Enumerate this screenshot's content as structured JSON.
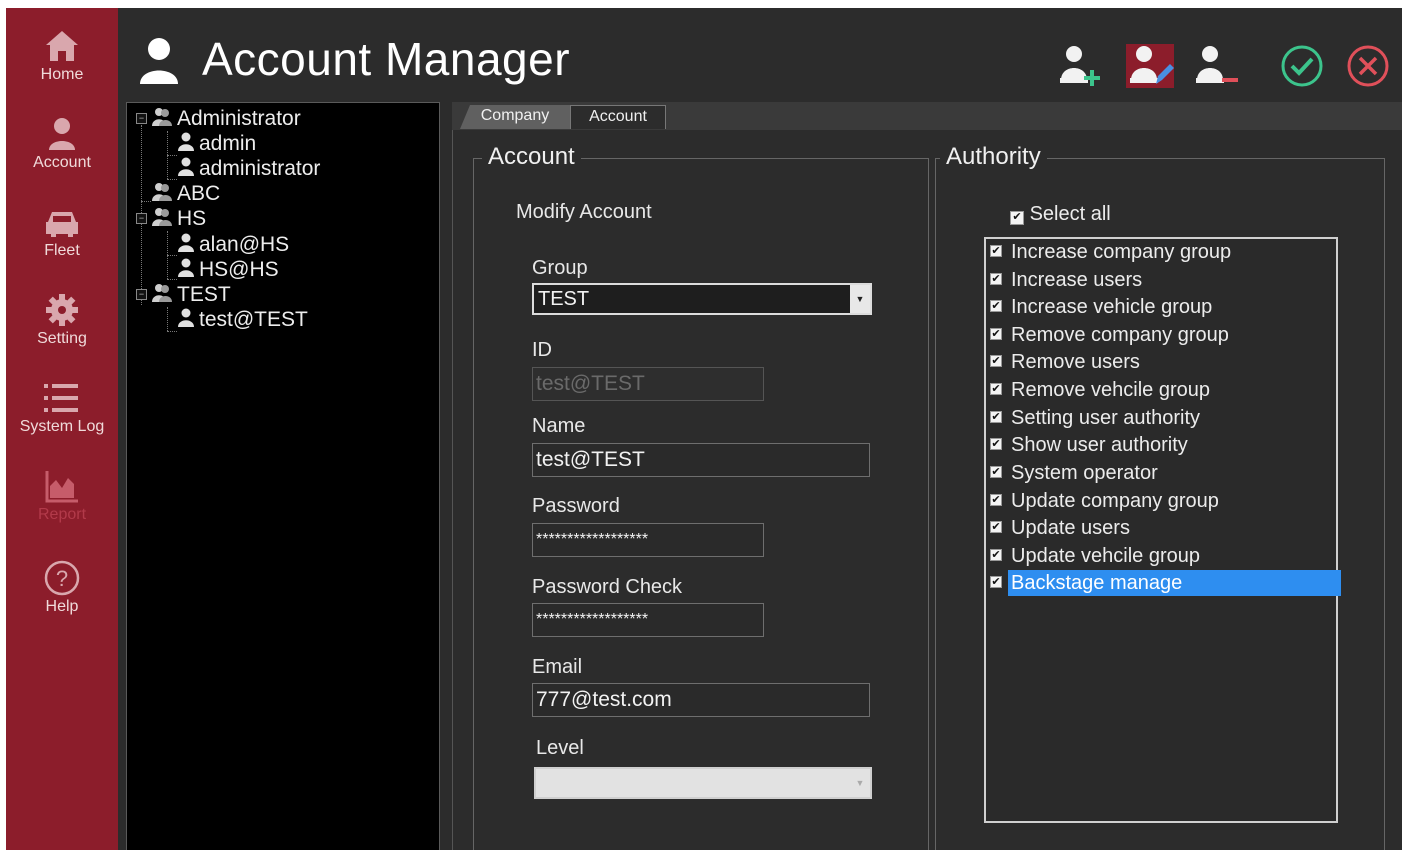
{
  "app": {
    "title": "Account Manager"
  },
  "sidebar": {
    "items": [
      {
        "label": "Home",
        "icon": "home-icon"
      },
      {
        "label": "Account",
        "icon": "user-icon"
      },
      {
        "label": "Fleet",
        "icon": "car-icon"
      },
      {
        "label": "Setting",
        "icon": "gear-icon"
      },
      {
        "label": "System Log",
        "icon": "list-icon"
      },
      {
        "label": "Report",
        "icon": "chart-icon",
        "disabled": true
      },
      {
        "label": "Help",
        "icon": "help-icon"
      }
    ]
  },
  "toolbar": {
    "buttons": [
      {
        "icon": "add-user-icon"
      },
      {
        "icon": "edit-user-icon",
        "active": true
      },
      {
        "icon": "remove-user-icon"
      },
      {
        "icon": "confirm-icon"
      },
      {
        "icon": "cancel-icon"
      }
    ]
  },
  "tree": {
    "groups": [
      {
        "label": "Administrator",
        "expanded": true,
        "children": [
          "admin",
          "administrator"
        ]
      },
      {
        "label": "ABC",
        "expanded": false,
        "children": []
      },
      {
        "label": "HS",
        "expanded": true,
        "children": [
          "alan@HS",
          "HS@HS"
        ]
      },
      {
        "label": "TEST",
        "expanded": true,
        "children": [
          "test@TEST"
        ]
      }
    ]
  },
  "tabs": [
    {
      "label": "Company",
      "active": false
    },
    {
      "label": "Account",
      "active": true
    }
  ],
  "account": {
    "title": "Account",
    "subtitle": "Modify Account",
    "group_label": "Group",
    "group_value": "TEST",
    "id_label": "ID",
    "id_value": "test@TEST",
    "name_label": "Name",
    "name_value": "test@TEST",
    "password_label": "Password",
    "password_value": "******************",
    "password_check_label": "Password Check",
    "password_check_value": "******************",
    "email_label": "Email",
    "email_value": "777@test.com",
    "level_label": "Level",
    "level_value": ""
  },
  "authority": {
    "title": "Authority",
    "select_all_label": "Select all",
    "select_all_checked": true,
    "items": [
      {
        "label": "Increase company group",
        "checked": true
      },
      {
        "label": "Increase users",
        "checked": true
      },
      {
        "label": "Increase vehicle group",
        "checked": true
      },
      {
        "label": "Remove company group",
        "checked": true
      },
      {
        "label": "Remove users",
        "checked": true
      },
      {
        "label": "Remove vehcile group",
        "checked": true
      },
      {
        "label": "Setting user authority",
        "checked": true
      },
      {
        "label": "Show user authority",
        "checked": true
      },
      {
        "label": "System operator",
        "checked": true
      },
      {
        "label": "Update company group",
        "checked": true
      },
      {
        "label": "Update users",
        "checked": true
      },
      {
        "label": "Update vehcile group",
        "checked": true
      },
      {
        "label": "Backstage manage",
        "checked": true,
        "selected": true
      }
    ]
  },
  "colors": {
    "sidebar": "#8c1d2b",
    "background": "#2c2c2c",
    "selection": "#2e8ef0",
    "confirm": "#3cc48c",
    "cancel": "#e0505a"
  }
}
